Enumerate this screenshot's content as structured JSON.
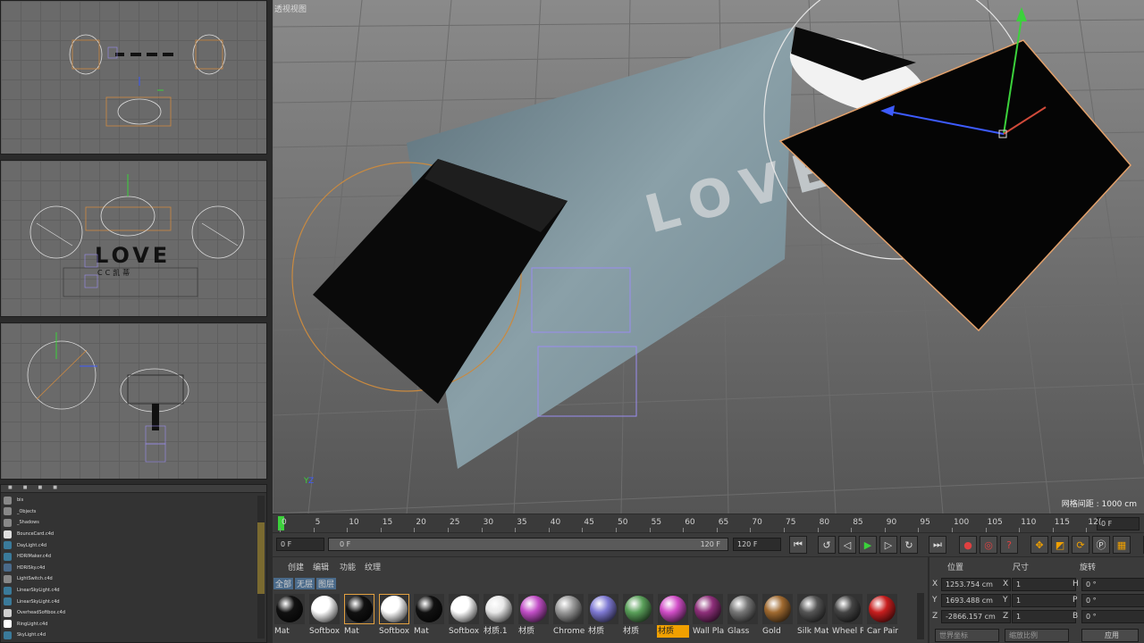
{
  "viewports": {
    "top_label": "",
    "mid_label": "",
    "bottom_label": "",
    "main_label": "透视视图",
    "grid_spacing": "网格间距 : 1000 cm"
  },
  "object_manager": {
    "items": [
      {
        "name": "bis",
        "icon": "file-icon"
      },
      {
        "name": "_Objects",
        "icon": "file-icon"
      },
      {
        "name": "_Shadows",
        "icon": "file-icon"
      },
      {
        "name": "BounceCard.c4d",
        "icon": "card-icon"
      },
      {
        "name": "DayLight.c4d",
        "icon": "sphere-icon"
      },
      {
        "name": "HDRIMaker.c4d",
        "icon": "sphere-icon"
      },
      {
        "name": "HDRISky.c4d",
        "icon": "sky-icon"
      },
      {
        "name": "LightSwitch.c4d",
        "icon": "file-icon"
      },
      {
        "name": "LinearSkyLight.c4d",
        "icon": "sphere-icon"
      },
      {
        "name": "LinearSkyLight.c4d",
        "icon": "sphere-icon"
      },
      {
        "name": "OverheadSoftbox.c4d",
        "icon": "softbox-icon"
      },
      {
        "name": "RingLight.c4d",
        "icon": "ring-icon"
      },
      {
        "name": "SkyLight.c4d",
        "icon": "sphere-icon"
      }
    ]
  },
  "timeline": {
    "ticks": [
      "0",
      "5",
      "10",
      "15",
      "20",
      "25",
      "30",
      "35",
      "40",
      "45",
      "50",
      "55",
      "60",
      "65",
      "70",
      "75",
      "80",
      "85",
      "90",
      "95",
      "100",
      "105",
      "110",
      "115",
      "12("
    ],
    "current_frame": "0 F",
    "start_frame": "0 F",
    "range_start": "0 F",
    "range_end": "120 F",
    "end_frame": "120 F"
  },
  "material_manager": {
    "menu": [
      "创建",
      "编辑",
      "功能",
      "纹理"
    ],
    "filters": [
      "全部",
      "无层",
      "图层"
    ],
    "materials": [
      {
        "name": "Mat",
        "color": "#111111"
      },
      {
        "name": "Softbox",
        "color": "#ffffff"
      },
      {
        "name": "Mat",
        "color": "#111111"
      },
      {
        "name": "Softbox",
        "color": "#ffffff"
      },
      {
        "name": "Mat",
        "color": "#111111"
      },
      {
        "name": "Softbox",
        "color": "#ffffff"
      },
      {
        "name": "材质.1",
        "color": "#e8e8e8"
      },
      {
        "name": "材质",
        "color": "#c34fc8"
      },
      {
        "name": "Chrome",
        "color": "#9a9a9a"
      },
      {
        "name": "材质",
        "color": "#7f7ad4"
      },
      {
        "name": "材质",
        "color": "#5aa05a"
      },
      {
        "name": "材质",
        "color": "#d24ec8"
      },
      {
        "name": "Wall Pla",
        "color": "#8e2f7a"
      },
      {
        "name": "Glass",
        "color": "#777777"
      },
      {
        "name": "Gold",
        "color": "#a06a30"
      },
      {
        "name": "Silk Mat",
        "color": "#555555"
      },
      {
        "name": "Wheel R",
        "color": "#444444"
      },
      {
        "name": "Car Pair",
        "color": "#c81e1e"
      }
    ]
  },
  "coordinates": {
    "headers": [
      "位置",
      "尺寸",
      "旋转"
    ],
    "rows": [
      {
        "axis": "X",
        "pos": "1253.754 cm",
        "size_axis": "X",
        "size": "1",
        "rot_axis": "H",
        "rot": "0 °"
      },
      {
        "axis": "Y",
        "pos": "1693.488 cm",
        "size_axis": "Y",
        "size": "1",
        "rot_axis": "P",
        "rot": "0 °"
      },
      {
        "axis": "Z",
        "pos": "-2866.157 cm",
        "size_axis": "Z",
        "size": "1",
        "rot_axis": "B",
        "rot": "0 °"
      }
    ],
    "world_coords": "世界坐标",
    "scale_ratio": "缩放比例",
    "apply": "应用"
  },
  "colors": {
    "accent": "#f0a000",
    "play_green": "#3bd13b"
  }
}
